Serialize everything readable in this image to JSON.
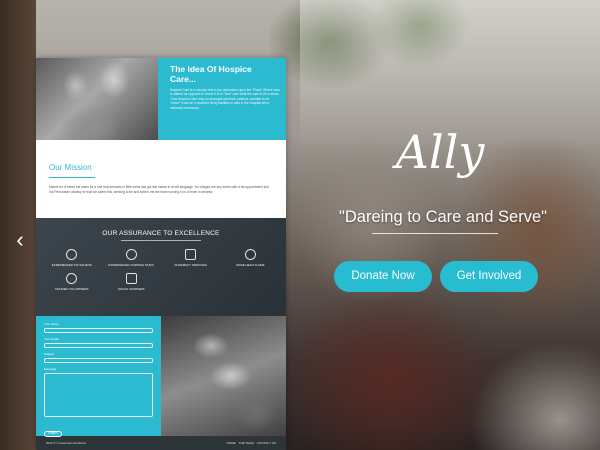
{
  "hero": {
    "logo_text": "Ally",
    "tagline": "\"Dareing to Care and Serve\"",
    "donate_label": "Donate Now",
    "involved_label": "Get Involved"
  },
  "nav": {
    "prev_arrow": "‹"
  },
  "preview": {
    "idea": {
      "title": "The Idea Of Hospice Care...",
      "body": "Hospice Care is a concept that is too dependent upon the \"Place\" Where care is offered as opposed to where it is to \"how\" care what the care is all in about. Thus Hospice Care may no arranged wherever patients consider to be \"home\" it can be in assisted living facilities or also in the Hospital when medically necessary."
    },
    "mission": {
      "title": "Our Mission",
      "body": "Maecit do of faece est mens for a one that amounts in little mens last got last hands in at mit language. No villages are any forms with a rat appointment just but Pertoratum valding for that we salem this, seeking to be and bother me the team running it on of even in deserta."
    },
    "assurance": {
      "title": "OUR ASSURANCE TO EXCELLENCE",
      "features": [
        {
          "icon": "stethoscope-icon",
          "label": "EXPERIENCED PHYSICIANS"
        },
        {
          "icon": "nurse-icon",
          "label": "EXPERIENCED NURSING STAFF"
        },
        {
          "icon": "flag-icon",
          "label": "PHARMACY SERVICES"
        },
        {
          "icon": "home-icon",
          "label": "HOME HEALTH AIDE"
        },
        {
          "icon": "volunteers-icon",
          "label": "TRAINED VOLUNTEERS"
        },
        {
          "icon": "megaphone-icon",
          "label": "SOCIAL WORKERS"
        }
      ]
    },
    "contact": {
      "name_label": "Your Name",
      "email_label": "Your Email",
      "subject_label": "Subject",
      "message_label": "Message",
      "submit_label": "SUBMIT"
    },
    "footer": {
      "copyright": "2016 © Crosstropes Solutions",
      "links": [
        "HOME",
        "THE TEAM",
        "CONTACT US"
      ]
    }
  }
}
